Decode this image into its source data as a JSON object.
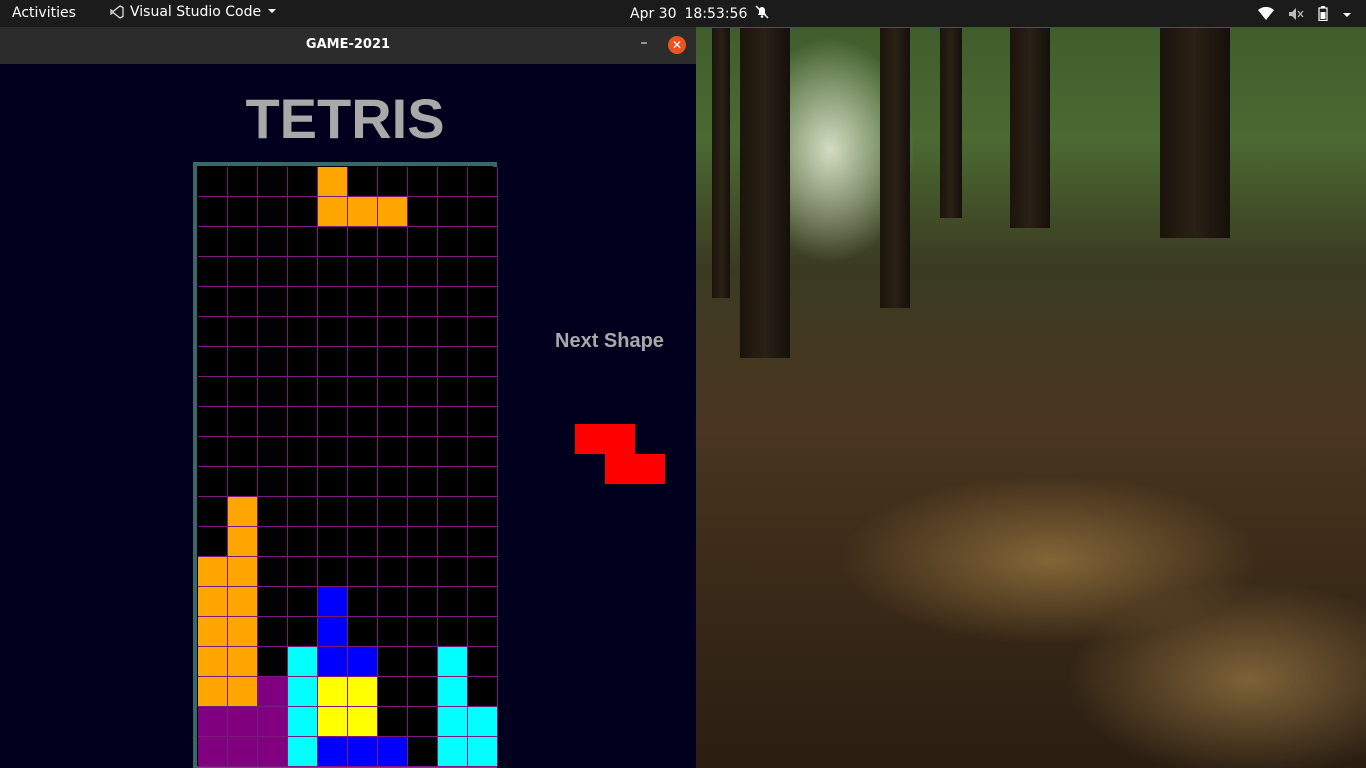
{
  "topbar": {
    "activities": "Activities",
    "app_name": "Visual Studio Code",
    "date": "Apr 30",
    "time": "18:53:56",
    "icons": [
      "notifications-off-icon",
      "wifi-icon",
      "volume-muted-icon",
      "battery-icon",
      "chevron-down-icon"
    ]
  },
  "window": {
    "title": "GAME-2021",
    "minimize_label": "–",
    "close_label": "✕"
  },
  "game": {
    "title": "TETRIS",
    "next_label": "Next Shape",
    "colors": {
      "orange": "#ffa500",
      "blue": "#0000ff",
      "cyan": "#00ffff",
      "yellow": "#ffff00",
      "purple": "#800080",
      "red": "#ff0000",
      "grid_line": "#7a1a7a",
      "board_border": "#3a6868",
      "background": "#00001e"
    },
    "board": {
      "columns": 10,
      "rows": 20,
      "filled_cells": [
        {
          "row": 0,
          "col": 4,
          "color": "orange"
        },
        {
          "row": 1,
          "col": 4,
          "color": "orange"
        },
        {
          "row": 1,
          "col": 5,
          "color": "orange"
        },
        {
          "row": 1,
          "col": 6,
          "color": "orange"
        },
        {
          "row": 11,
          "col": 1,
          "color": "orange"
        },
        {
          "row": 12,
          "col": 1,
          "color": "orange"
        },
        {
          "row": 13,
          "col": 0,
          "color": "orange"
        },
        {
          "row": 13,
          "col": 1,
          "color": "orange"
        },
        {
          "row": 14,
          "col": 0,
          "color": "orange"
        },
        {
          "row": 14,
          "col": 1,
          "color": "orange"
        },
        {
          "row": 15,
          "col": 0,
          "color": "orange"
        },
        {
          "row": 15,
          "col": 1,
          "color": "orange"
        },
        {
          "row": 16,
          "col": 0,
          "color": "orange"
        },
        {
          "row": 16,
          "col": 1,
          "color": "orange"
        },
        {
          "row": 17,
          "col": 0,
          "color": "orange"
        },
        {
          "row": 17,
          "col": 1,
          "color": "orange"
        },
        {
          "row": 14,
          "col": 4,
          "color": "blue"
        },
        {
          "row": 15,
          "col": 4,
          "color": "blue"
        },
        {
          "row": 16,
          "col": 4,
          "color": "blue"
        },
        {
          "row": 16,
          "col": 5,
          "color": "blue"
        },
        {
          "row": 16,
          "col": 3,
          "color": "cyan"
        },
        {
          "row": 17,
          "col": 3,
          "color": "cyan"
        },
        {
          "row": 18,
          "col": 3,
          "color": "cyan"
        },
        {
          "row": 19,
          "col": 3,
          "color": "cyan"
        },
        {
          "row": 16,
          "col": 8,
          "color": "cyan"
        },
        {
          "row": 17,
          "col": 8,
          "color": "cyan"
        },
        {
          "row": 18,
          "col": 8,
          "color": "cyan"
        },
        {
          "row": 18,
          "col": 9,
          "color": "cyan"
        },
        {
          "row": 19,
          "col": 8,
          "color": "cyan"
        },
        {
          "row": 19,
          "col": 9,
          "color": "cyan"
        },
        {
          "row": 17,
          "col": 4,
          "color": "yellow"
        },
        {
          "row": 17,
          "col": 5,
          "color": "yellow"
        },
        {
          "row": 18,
          "col": 4,
          "color": "yellow"
        },
        {
          "row": 18,
          "col": 5,
          "color": "yellow"
        },
        {
          "row": 17,
          "col": 2,
          "color": "purple"
        },
        {
          "row": 18,
          "col": 0,
          "color": "purple"
        },
        {
          "row": 18,
          "col": 1,
          "color": "purple"
        },
        {
          "row": 18,
          "col": 2,
          "color": "purple"
        },
        {
          "row": 19,
          "col": 0,
          "color": "purple"
        },
        {
          "row": 19,
          "col": 1,
          "color": "purple"
        },
        {
          "row": 19,
          "col": 2,
          "color": "purple"
        },
        {
          "row": 19,
          "col": 4,
          "color": "blue"
        },
        {
          "row": 19,
          "col": 5,
          "color": "blue"
        },
        {
          "row": 19,
          "col": 6,
          "color": "blue"
        }
      ]
    },
    "next_shape": {
      "name": "Z",
      "color": "red",
      "cells": [
        {
          "row": 0,
          "col": 0
        },
        {
          "row": 0,
          "col": 1
        },
        {
          "row": 1,
          "col": 1
        },
        {
          "row": 1,
          "col": 2
        }
      ]
    }
  }
}
